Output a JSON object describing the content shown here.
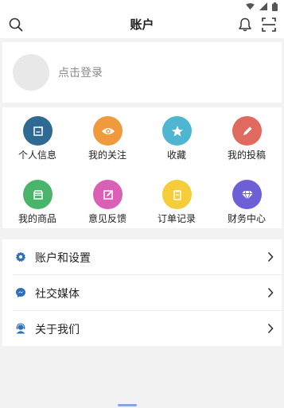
{
  "header": {
    "title": "账户"
  },
  "login": {
    "prompt": "点击登录"
  },
  "grid": {
    "items": [
      {
        "label": "个人信息",
        "icon": "edit-doc-icon",
        "color": "#2f6a92"
      },
      {
        "label": "我的关注",
        "icon": "eye-icon",
        "color": "#f09a3e"
      },
      {
        "label": "收藏",
        "icon": "star-icon",
        "color": "#4fb6d2"
      },
      {
        "label": "我的投稿",
        "icon": "pencil-icon",
        "color": "#e06a5f"
      },
      {
        "label": "我的商品",
        "icon": "shop-icon",
        "color": "#49b56b"
      },
      {
        "label": "意见反馈",
        "icon": "feedback-icon",
        "color": "#d960b4"
      },
      {
        "label": "订单记录",
        "icon": "order-icon",
        "color": "#f5cc3a"
      },
      {
        "label": "财务中心",
        "icon": "diamond-icon",
        "color": "#6d5fd6"
      }
    ]
  },
  "menu": {
    "items": [
      {
        "label": "账户和设置",
        "icon": "gear-icon"
      },
      {
        "label": "社交媒体",
        "icon": "messenger-icon"
      },
      {
        "label": "关于我们",
        "icon": "support-agent-icon"
      }
    ]
  },
  "colors": {
    "accent": "#2f6fb7",
    "background": "#f2f2f2"
  }
}
